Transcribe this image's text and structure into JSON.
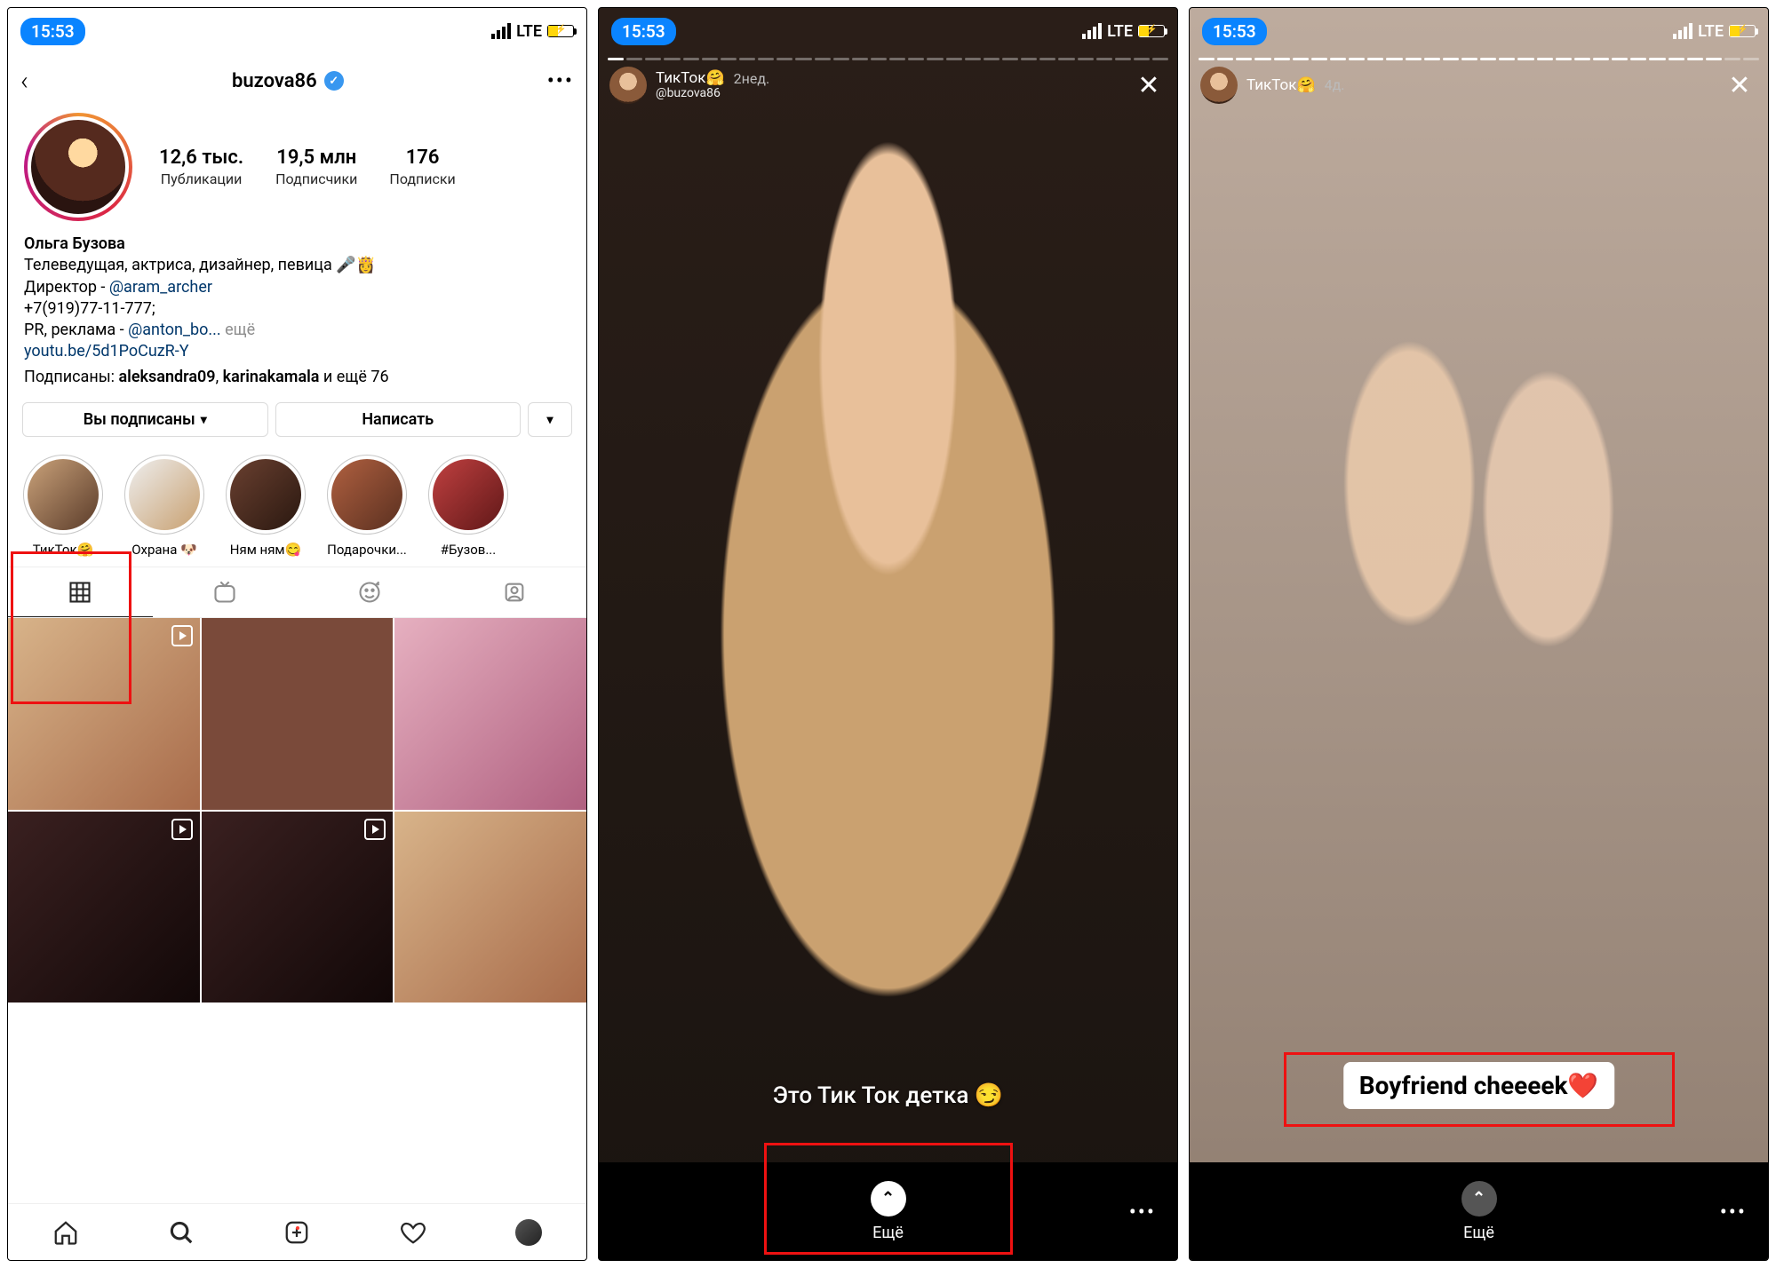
{
  "status": {
    "time": "15:53",
    "network": "LTE"
  },
  "screen1": {
    "username": "buzova86",
    "stats": {
      "posts_value": "12,6 тыс.",
      "posts_label": "Публикации",
      "followers_value": "19,5 млн",
      "followers_label": "Подписчики",
      "following_value": "176",
      "following_label": "Подписки"
    },
    "bio": {
      "name": "Ольга Бузова",
      "line1": "Телеведущая, актриса, дизайнер, певица 🎤👸",
      "director_prefix": "Директор - ",
      "director_mention": "@aram_archer",
      "phone": "+7(919)77-11-777;",
      "pr_prefix": "PR, реклама - ",
      "pr_mention": "@anton_bo...",
      "more": " ещё",
      "site": "youtu.be/5d1PoCuzR-Y",
      "followed_prefix": "Подписаны: ",
      "followed_1": "aleksandra09",
      "followed_2": "karinakamala",
      "followed_suffix": " и ещё 76"
    },
    "actions": {
      "following": "Вы подписаны",
      "message": "Написать"
    },
    "highlights": [
      {
        "label": "ТикТок🤗"
      },
      {
        "label": "Охрана 🐶"
      },
      {
        "label": "Ням ням😋"
      },
      {
        "label": "Подарочки..."
      },
      {
        "label": "#Бузов..."
      }
    ]
  },
  "screen2": {
    "highlight_name": "ТикТок🤗",
    "age": "2нед.",
    "handle": "@buzova86",
    "caption": "Это Тик Ток детка 😏",
    "swipe_label": "Ещё"
  },
  "screen3": {
    "highlight_name": "ТикТок🤗",
    "age": "4д.",
    "caption": "Boyfriend cheeeek❤️",
    "swipe_label": "Ещё"
  }
}
